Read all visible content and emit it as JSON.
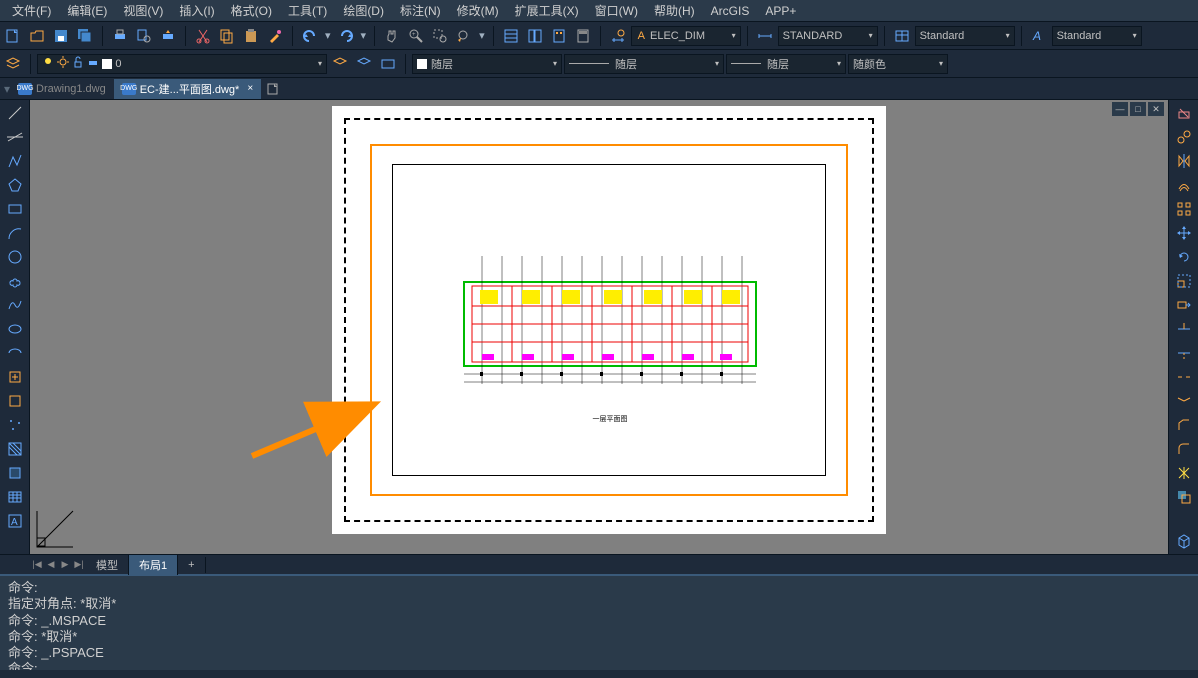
{
  "menu": [
    "文件(F)",
    "编辑(E)",
    "视图(V)",
    "插入(I)",
    "格式(O)",
    "工具(T)",
    "绘图(D)",
    "标注(N)",
    "修改(M)",
    "扩展工具(X)",
    "窗口(W)",
    "帮助(H)",
    "ArcGIS",
    "APP+"
  ],
  "toolbar1": {
    "style_current": "ELEC_DIM",
    "dim_style": "STANDARD",
    "table_style": "Standard",
    "text_style": "Standard"
  },
  "toolbar2": {
    "layer_color_label": "0",
    "linecolor": "随层",
    "linetype": "随层",
    "lineweight": "随层",
    "plot_style": "随颜色"
  },
  "tabs": [
    {
      "label": "Drawing1.dwg",
      "active": false
    },
    {
      "label": "EC-建...平面图.dwg*",
      "active": true
    }
  ],
  "bottom_tabs": {
    "items": [
      "模型",
      "布局1"
    ],
    "active": 1,
    "plus": "+"
  },
  "cmd_lines": [
    "命令:",
    "指定对角点: *取消*",
    "命令: _.MSPACE",
    "命令: *取消*",
    "命令: _.PSPACE",
    "命令:"
  ],
  "floorplan_caption": "一层平面图",
  "win_controls": {
    "min": "—",
    "max": "□",
    "close": "✕"
  },
  "tab_close": "×",
  "icons": {
    "dwg": "DWG",
    "triangle_down": "▾",
    "chevl": "◀",
    "chevr": "▶",
    "chevll": "|◀",
    "chevrr": "▶|"
  }
}
